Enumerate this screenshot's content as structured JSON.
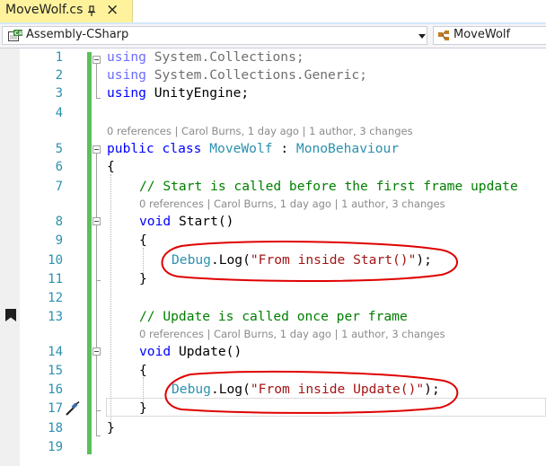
{
  "tab": {
    "title": "MoveWolf.cs",
    "pin_icon": "pin-icon",
    "close_icon": "close-icon",
    "close_glyph": "×"
  },
  "navigation": {
    "project": "Assembly-CSharp",
    "class": "MoveWolf",
    "project_icon": "csharp-project-icon",
    "class_icon": "class-icon"
  },
  "editor": {
    "lines": {
      "1": "1",
      "2": "2",
      "3": "3",
      "4": "4",
      "5": "5",
      "6": "6",
      "7": "7",
      "8": "8",
      "9": "9",
      "10": "10",
      "11": "11",
      "12": "12",
      "13": "13",
      "14": "14",
      "15": "15",
      "16": "16",
      "17": "17",
      "18": "18",
      "19": "19"
    },
    "code": {
      "l1_kw": "using",
      "l1_rest": " System.Collections;",
      "l2_kw": "using",
      "l2_rest": " System.Collections.Generic;",
      "l3_kw": "using",
      "l3_rest": " UnityEngine;",
      "l5_kw1": "public",
      "l5_kw2": "class",
      "l5_type": "MoveWolf",
      "l5_colon": " : ",
      "l5_base": "MonoBehaviour",
      "l6": "{",
      "l7_comment": "// Start is called before the first frame update",
      "l8_kw": "void",
      "l8_rest": " Start()",
      "l9": "{",
      "l10_type": "Debug",
      "l10_call": ".Log(",
      "l10_str": "\"From inside Start()\"",
      "l10_end": ");",
      "l11": "}",
      "l13_comment": "// Update is called once per frame",
      "l14_kw": "void",
      "l14_rest": " Update()",
      "l15": "{",
      "l16_type": "Debug",
      "l16_call": ".Log(",
      "l16_str": "\"From inside Update()\"",
      "l16_end": ");",
      "l17": "}",
      "l18": "}"
    },
    "codelens": {
      "class": "0 references | Carol Burns, 1 day ago | 1 author, 3 changes",
      "start": "0 references | Carol Burns, 1 day ago | 1 author, 3 changes",
      "update": "0 references | Carol Burns, 1 day ago | 1 author, 3 changes"
    },
    "glyphs": {
      "bookmark_icon": "bookmark-icon",
      "edit_icon": "quick-actions-screwdriver-icon"
    }
  },
  "colors": {
    "tab_active": "#fff29d",
    "keyword": "#0000ff",
    "type": "#2b91af",
    "string": "#a31515",
    "comment": "#008000",
    "line_number": "#2b91af",
    "change_bar": "#58c158",
    "annotation": "#e00000"
  }
}
